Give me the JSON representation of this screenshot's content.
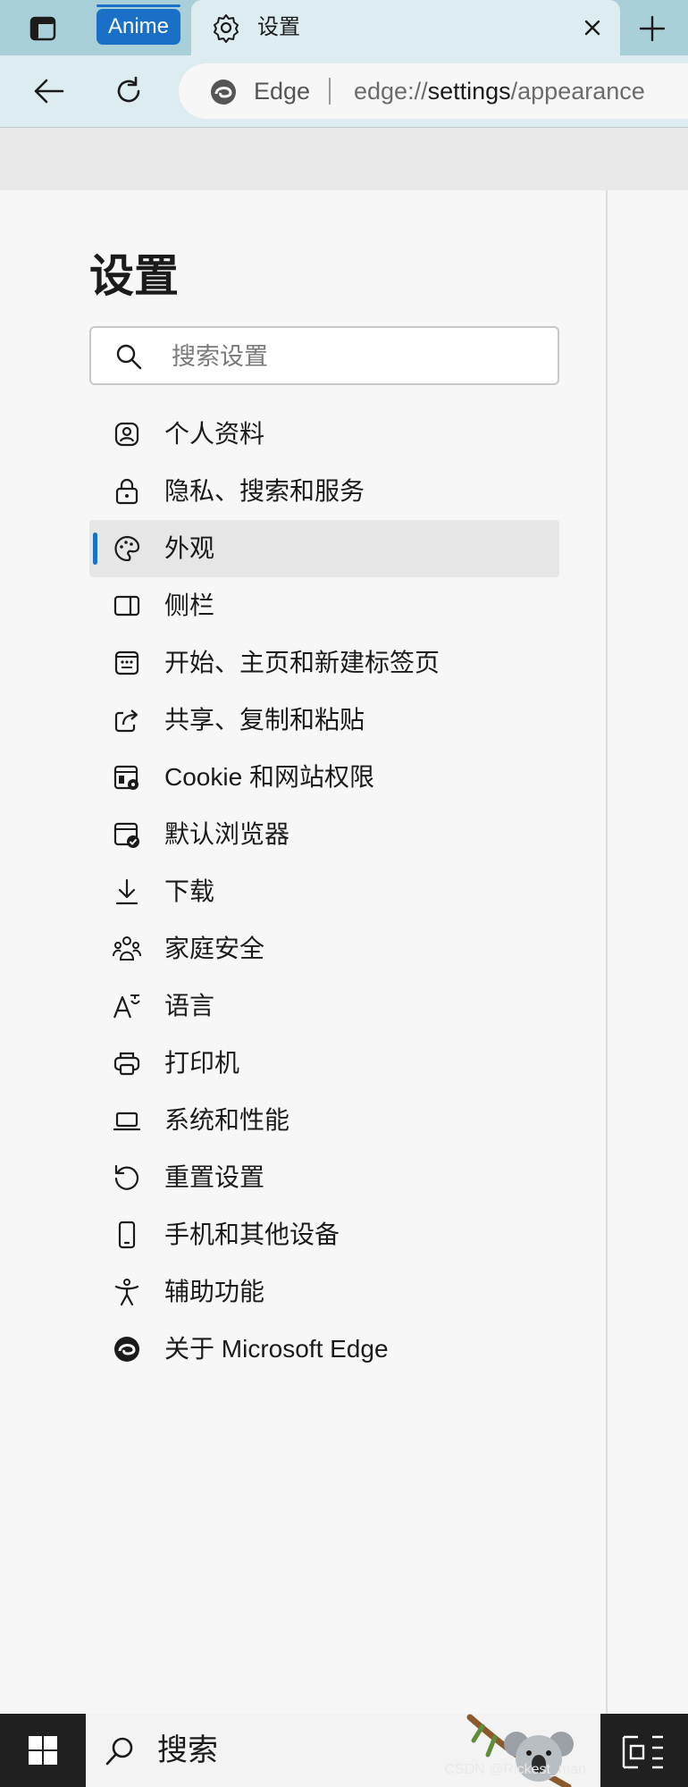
{
  "tabs": {
    "group_label": "Anime",
    "active_title": "设置"
  },
  "toolbar": {
    "site_label": "Edge",
    "url_scheme": "edge://",
    "url_host": "settings",
    "url_path": "/appearance"
  },
  "settings": {
    "title": "设置",
    "search_placeholder": "搜索设置",
    "menu": [
      {
        "label": "个人资料",
        "icon": "profile-icon"
      },
      {
        "label": "隐私、搜索和服务",
        "icon": "lock-icon"
      },
      {
        "label": "外观",
        "icon": "palette-icon",
        "active": true
      },
      {
        "label": "侧栏",
        "icon": "sidebar-icon"
      },
      {
        "label": "开始、主页和新建标签页",
        "icon": "home-grid-icon"
      },
      {
        "label": "共享、复制和粘贴",
        "icon": "share-icon"
      },
      {
        "label": "Cookie 和网站权限",
        "icon": "cookie-settings-icon"
      },
      {
        "label": "默认浏览器",
        "icon": "default-browser-icon"
      },
      {
        "label": "下载",
        "icon": "download-icon"
      },
      {
        "label": "家庭安全",
        "icon": "family-icon"
      },
      {
        "label": "语言",
        "icon": "language-icon"
      },
      {
        "label": "打印机",
        "icon": "printer-icon"
      },
      {
        "label": "系统和性能",
        "icon": "laptop-icon"
      },
      {
        "label": "重置设置",
        "icon": "reset-icon"
      },
      {
        "label": "手机和其他设备",
        "icon": "phone-icon"
      },
      {
        "label": "辅助功能",
        "icon": "accessibility-icon"
      },
      {
        "label": "关于 Microsoft Edge",
        "icon": "edge-logo-icon"
      }
    ]
  },
  "taskbar": {
    "search_label": "搜索",
    "watermark": "CSDN @Rickest_man"
  },
  "colors": {
    "accent": "#1a70c7",
    "tabstrip": "#a9cfd8",
    "toolbar": "#dcecf0",
    "taskbar": "#202020"
  }
}
